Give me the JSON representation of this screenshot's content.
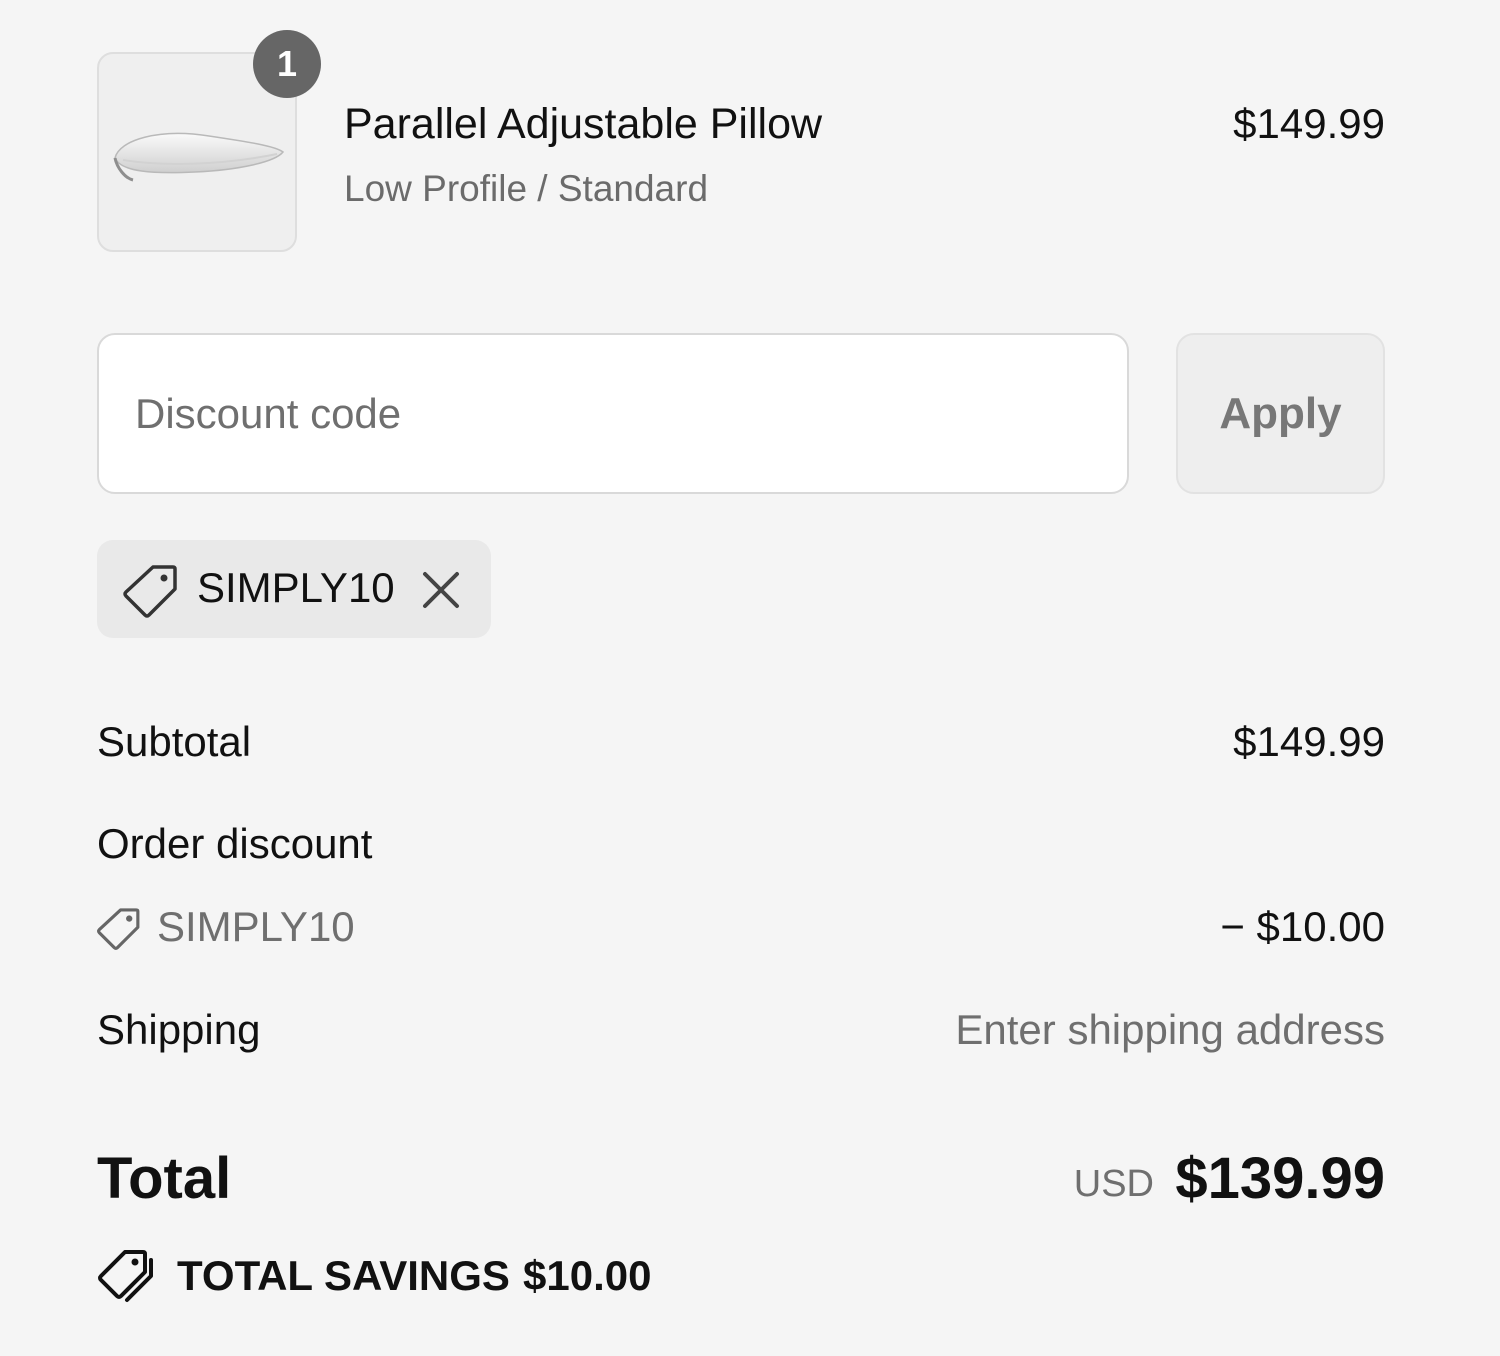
{
  "line_item": {
    "quantity": "1",
    "name": "Parallel Adjustable Pillow",
    "variant": "Low Profile / Standard",
    "price": "$149.99",
    "image_icon": "pillow-image"
  },
  "discount": {
    "placeholder": "Discount code",
    "value": "",
    "apply_label": "Apply",
    "applied_code": "SIMPLY10",
    "tag_icon": "tag-icon",
    "remove_icon": "close-icon"
  },
  "summary": {
    "subtotal_label": "Subtotal",
    "subtotal_value": "$149.99",
    "order_discount_label": "Order discount",
    "order_discount_code": "SIMPLY10",
    "order_discount_value": "− $10.00",
    "shipping_label": "Shipping",
    "shipping_value": "Enter shipping address"
  },
  "total": {
    "label": "Total",
    "currency": "USD",
    "amount": "$139.99"
  },
  "savings": {
    "icon": "tags-icon",
    "label": "TOTAL SAVINGS",
    "amount": "$10.00"
  }
}
